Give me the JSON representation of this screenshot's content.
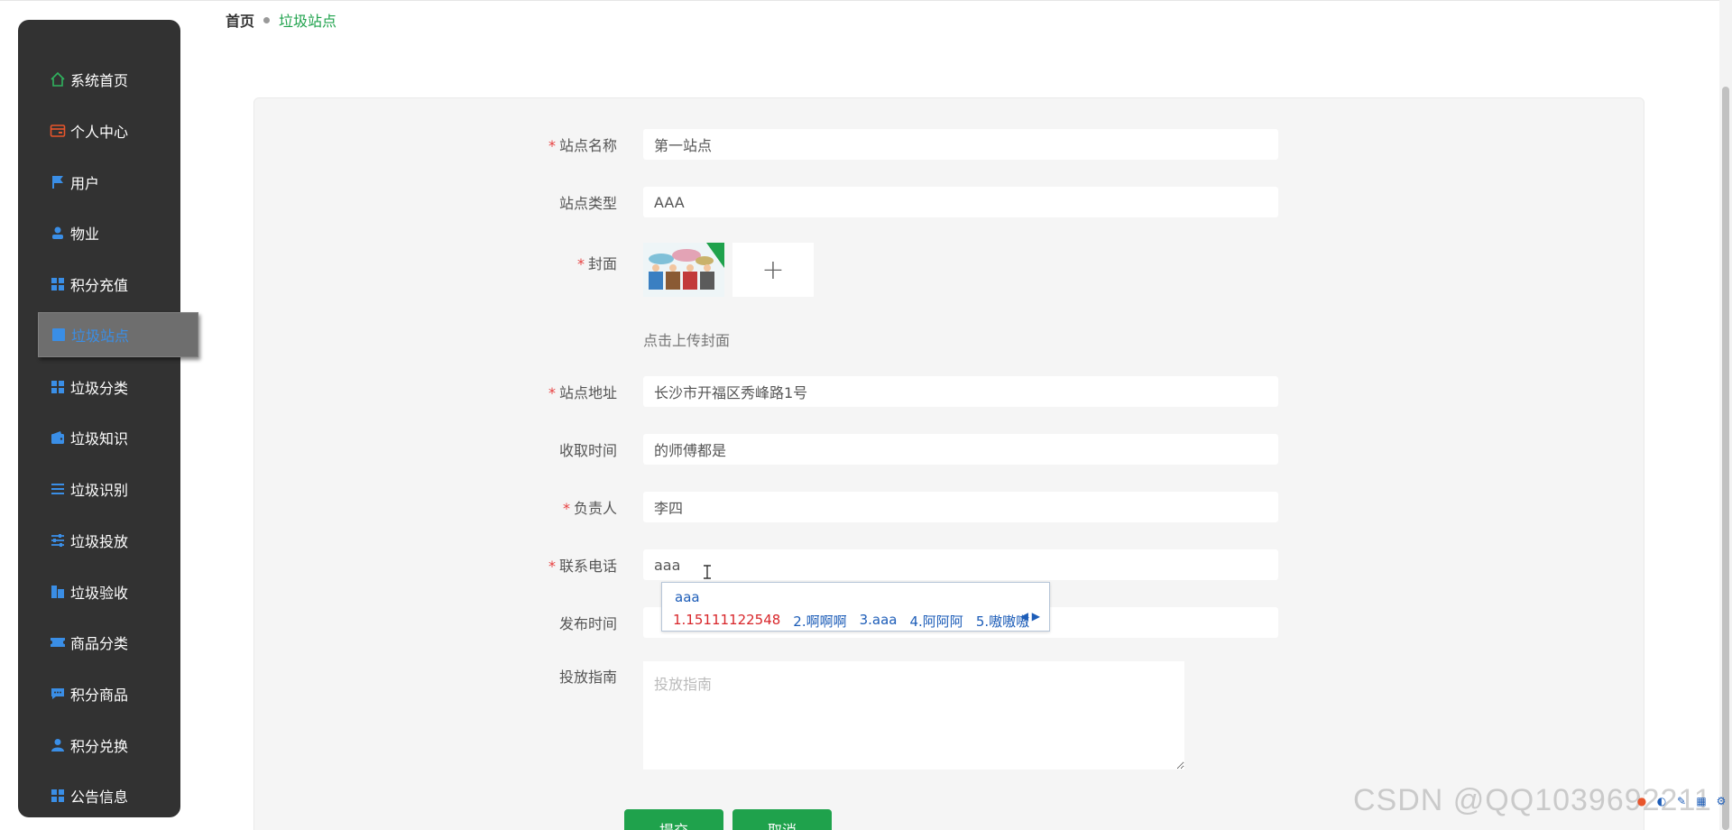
{
  "breadcrumb": {
    "home": "首页",
    "current": "垃圾站点"
  },
  "sidebar": {
    "items": [
      {
        "label": "系统首页",
        "icon": "home-icon",
        "color": "#2fb35e"
      },
      {
        "label": "个人中心",
        "icon": "card-icon",
        "color": "#e8552b"
      },
      {
        "label": "用户",
        "icon": "flag-icon",
        "color": "#3a8ee6"
      },
      {
        "label": "物业",
        "icon": "person-icon",
        "color": "#3a8ee6"
      },
      {
        "label": "积分充值",
        "icon": "grid-icon",
        "color": "#3a8ee6"
      },
      {
        "label": "垃圾站点",
        "icon": "square-icon",
        "color": "#3a8ee6"
      },
      {
        "label": "垃圾分类",
        "icon": "grid-icon",
        "color": "#3a8ee6"
      },
      {
        "label": "垃圾知识",
        "icon": "wallet-icon",
        "color": "#3a8ee6"
      },
      {
        "label": "垃圾识别",
        "icon": "list-icon",
        "color": "#3a8ee6"
      },
      {
        "label": "垃圾投放",
        "icon": "sliders-icon",
        "color": "#3a8ee6"
      },
      {
        "label": "垃圾验收",
        "icon": "building-icon",
        "color": "#3a8ee6"
      },
      {
        "label": "商品分类",
        "icon": "ticket-icon",
        "color": "#3a8ee6"
      },
      {
        "label": "积分商品",
        "icon": "chat-icon",
        "color": "#3a8ee6"
      },
      {
        "label": "积分兑换",
        "icon": "user-icon",
        "color": "#3a8ee6"
      },
      {
        "label": "公告信息",
        "icon": "grid-icon",
        "color": "#3a8ee6"
      }
    ],
    "active_index": 5
  },
  "form": {
    "station_name": {
      "label": "站点名称",
      "value": "第一站点",
      "required": true
    },
    "station_type": {
      "label": "站点类型",
      "value": "AAA",
      "required": false
    },
    "cover": {
      "label": "封面",
      "required": true,
      "hint": "点击上传封面",
      "add": "+"
    },
    "address": {
      "label": "站点地址",
      "value": "长沙市开福区秀峰路1号",
      "required": true
    },
    "collect_time": {
      "label": "收取时间",
      "value": "的师傅都是",
      "required": false
    },
    "manager": {
      "label": "负责人",
      "value": "李四",
      "required": true
    },
    "phone": {
      "label": "联系电话",
      "value": "aaa",
      "required": true
    },
    "publish_time": {
      "label": "发布时间",
      "value": "",
      "required": false
    },
    "guide": {
      "label": "投放指南",
      "placeholder": "投放指南",
      "required": false
    },
    "submit_label": "提交",
    "cancel_label": "取消"
  },
  "ime": {
    "composition": "aaa",
    "candidates": [
      "1.15111122548",
      "2.啊啊啊",
      "3.aaa",
      "4.阿阿阿",
      "5.嗷嗷嗷"
    ]
  },
  "watermark": "CSDN @QQ1039692211",
  "colors": {
    "accent": "#1fa24c",
    "sidebar_bg": "#323232",
    "active_text": "#3a8ee6",
    "required": "#e84040"
  }
}
